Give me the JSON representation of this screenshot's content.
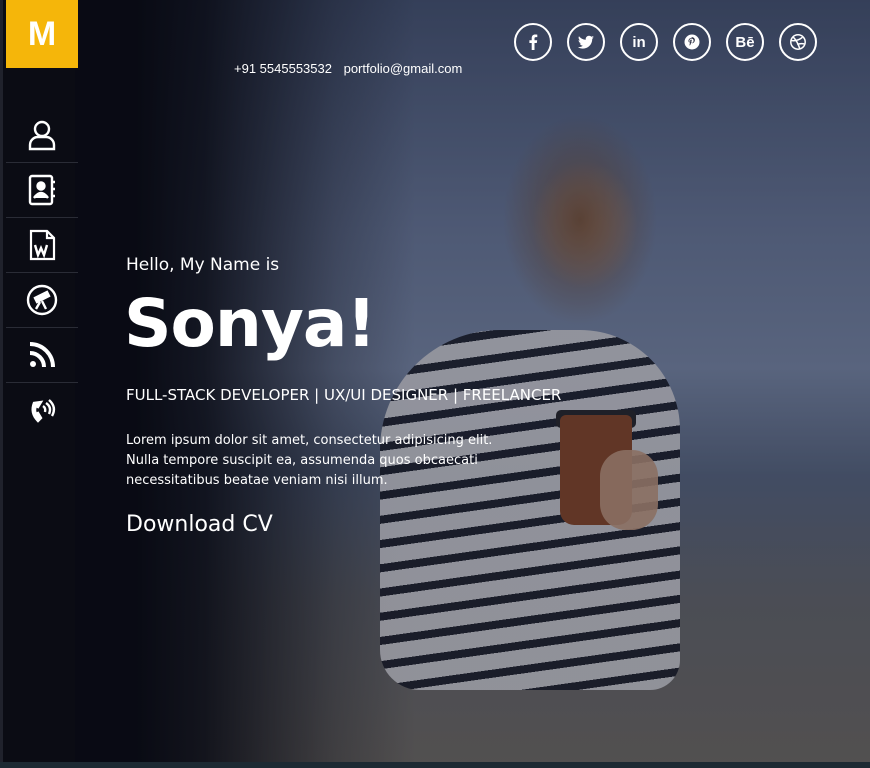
{
  "brand": {
    "logo_letter": "M",
    "accent": "#f5b60a"
  },
  "sidebar": {
    "items": [
      {
        "icon": "user-icon"
      },
      {
        "icon": "contact-book-icon"
      },
      {
        "icon": "word-document-icon"
      },
      {
        "icon": "telescope-icon"
      },
      {
        "icon": "rss-icon"
      },
      {
        "icon": "phone-icon"
      }
    ]
  },
  "header": {
    "phone": "+91 5545553532",
    "email": "portfolio@gmail.com",
    "socials": [
      {
        "icon": "facebook-icon"
      },
      {
        "icon": "twitter-icon"
      },
      {
        "icon": "linkedin-icon",
        "label": "in"
      },
      {
        "icon": "pinterest-icon"
      },
      {
        "icon": "behance-icon",
        "label": "Bē"
      },
      {
        "icon": "dribbble-icon"
      }
    ]
  },
  "hero": {
    "greeting": "Hello, My Name is",
    "name": "Sonya!",
    "roles": "FULL-STACK DEVELOPER | UX/UI DESIGNER | FREELANCER",
    "bio_lines": [
      "Lorem ipsum dolor sit amet, consectetur adipisicing elit.",
      "Nulla tempore suscipit ea, assumenda quos obcaecati",
      "necessitatibus beatae veniam nisi illum."
    ],
    "cta": "Download CV"
  }
}
